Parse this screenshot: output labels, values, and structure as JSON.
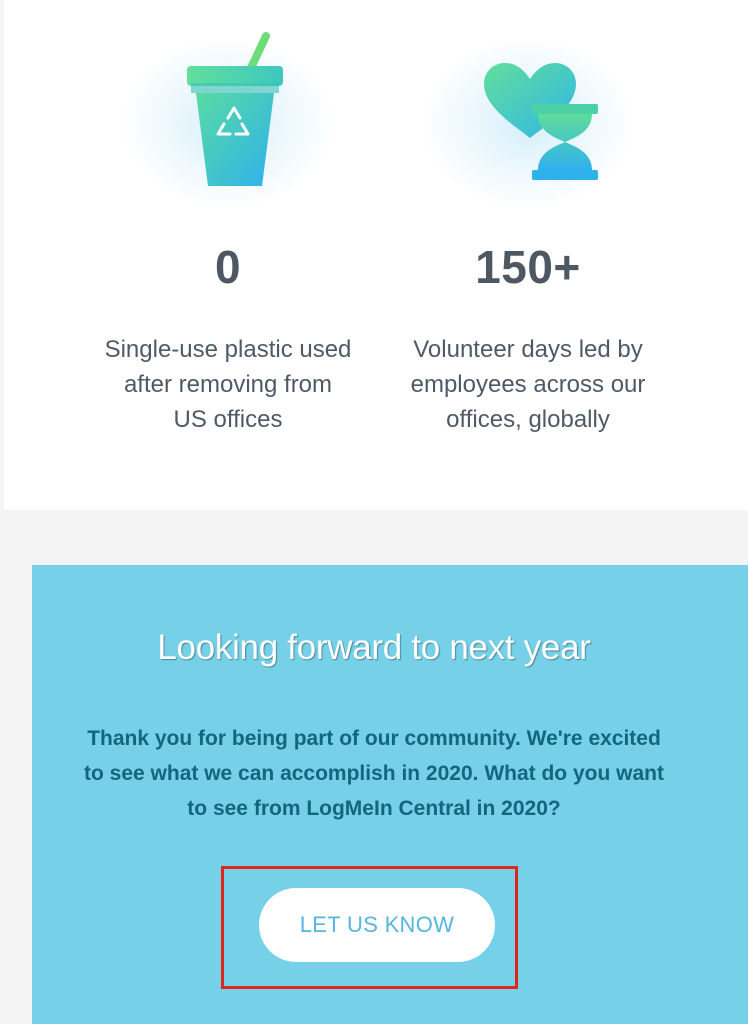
{
  "stats": [
    {
      "icon": "recycle-cup-icon",
      "value": "0",
      "lines": [
        "Single-use plastic used",
        "after removing from",
        "US offices"
      ]
    },
    {
      "icon": "heart-hourglass-icon",
      "value": "150+",
      "lines": [
        "Volunteer days led by",
        "employees across our",
        "offices, globally"
      ]
    }
  ],
  "cta": {
    "title": "Looking forward to next year",
    "body_lines": [
      "Thank you for being part of our community. We're excited",
      "to see what we can accomplish in 2020. What do you want",
      "to see from LogMeIn Central in 2020?"
    ],
    "button_label": "LET US KNOW"
  },
  "colors": {
    "cta_background": "#75d0e8",
    "button_text": "#57b6e0",
    "highlight_border": "#e0261b",
    "stat_text": "#4d5863"
  }
}
